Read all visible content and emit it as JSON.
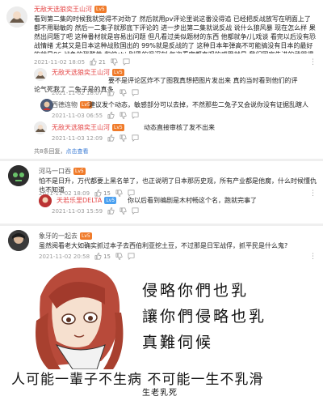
{
  "comments": [
    {
      "username": "无敌天选狼奕王山河",
      "level": "Lv5",
      "text": "看到第二集的时候我就觉得不对劲了 然后就用pv评论里说这番没得追 已经把反战放写在明面上了 都不用聪敏的 然后一二集子就那底下评论的 进一步出第二集就说反战 说什么狼风暴 现在怎么样 果然出问题了吧 这种番材就是容易出问题 但凡看过类似题材的东西 他都就争/儿戏谈 看完以后没有恐战情绪 尤其又是日本这种战败国出的 99%就是反战的了 这种日本年弹高不可能搞没有日本的最好的就是86 战争的残酷性 和伸shi 别黑的很深刻 每次看完都直观的感受就是 我们国家先进的武器得有不能让人欺负 还有就是希望这世界上永远没有战争 我真不是搏一搏一 好号与环就贴脸了了",
      "time": "2021-11-02 18:05",
      "likes": "21"
    },
    {
      "username": "河马一口吞",
      "level": "Lv5",
      "text": "怕不是日升，万代都要上黑名单了，也正说明了日本那历史观，所有产业都是他腐，什么时候懂仇也不知道",
      "time": "2021-11-02 18:09",
      "likes": "15"
    },
    {
      "username": "象牙的一起去",
      "level": "Lv5",
      "text": "虽然阅看老大如确实抓过本子去西伯利亚挖土豆，不过那是日军战俘，抓平民是什么鬼?",
      "time": "2021-11-02 20:58",
      "likes": "15"
    }
  ],
  "replies": [
    {
      "username": "无敌天选狼奕王山河",
      "level": "Lv5",
      "text": "要不是评论区炸不了图我真想把图片发出来 真的当时看到他们的评论气死我了 二兔子是的真多",
      "time": "2021-11-02 18:07"
    },
    {
      "username": "西德连物",
      "level": "Lv5",
      "text": "建议发个动态，敏感部分可以去掉，不然那些二兔子又会说你没有证据乱瞎人",
      "time": "2021-11-03 06:55"
    },
    {
      "username": "无敌天选狼奕王山河",
      "level": "Lv5",
      "text": "动态直接审核了发不出来",
      "time": "2021-11-03 12:09"
    }
  ],
  "reply_more": "共8条回复，",
  "reply_more_link": "点击查看",
  "reply2": {
    "username": "天若乐里DELTA",
    "level": "Lv5",
    "text": "你以后看到编剧是木村畅这个名，跑就完事了",
    "time": "2021-11-03 15:59"
  },
  "meme": {
    "line1": "侵略你們也乳",
    "line2": "讓你們侵略也乳",
    "line3": "真難伺候",
    "caption": "人可能一輩子不生病 不可能一生不乳滑",
    "sub": "生老乳死"
  }
}
